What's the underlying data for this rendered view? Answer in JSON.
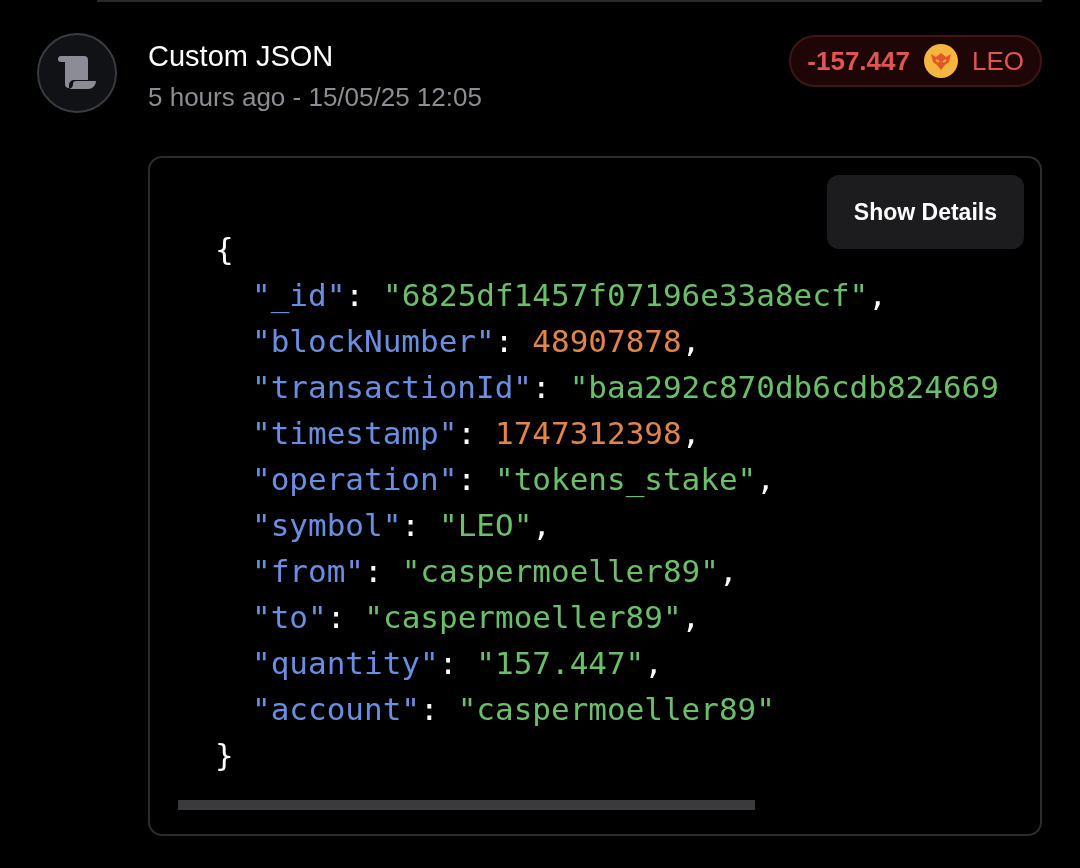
{
  "transaction": {
    "title": "Custom JSON",
    "time": "5 hours ago - 15/05/25 12:05",
    "amount": {
      "value": "-157.447",
      "symbol": "LEO"
    }
  },
  "details": {
    "button": "Show Details",
    "open_brace": "{",
    "close_brace": "}",
    "lines": [
      {
        "key": "\"_id\"",
        "sep": ":",
        "value": "\"6825df1457f07196e33a8ecf\"",
        "kind": "string",
        "end": ","
      },
      {
        "key": "\"blockNumber\"",
        "sep": ":",
        "value": "48907878",
        "kind": "number",
        "end": ","
      },
      {
        "key": "\"transactionId\"",
        "sep": ":",
        "value": "\"baa292c870db6cdb824669",
        "kind": "string"
      },
      {
        "key": "\"timestamp\"",
        "sep": ":",
        "value": "1747312398",
        "kind": "number",
        "end": ","
      },
      {
        "key": "\"operation\"",
        "sep": ":",
        "value": "\"tokens_stake\"",
        "kind": "string",
        "end": ","
      },
      {
        "key": "\"symbol\"",
        "sep": ":",
        "value": "\"LEO\"",
        "kind": "string",
        "end": ","
      },
      {
        "key": "\"from\"",
        "sep": ":",
        "value": "\"caspermoeller89\"",
        "kind": "string",
        "end": ","
      },
      {
        "key": "\"to\"",
        "sep": ":",
        "value": "\"caspermoeller89\"",
        "kind": "string",
        "end": ","
      },
      {
        "key": "\"quantity\"",
        "sep": ":",
        "value": "\"157.447\"",
        "kind": "string",
        "end": ","
      },
      {
        "key": "\"account\"",
        "sep": ":",
        "value": "\"caspermoeller89\"",
        "kind": "string"
      }
    ]
  }
}
